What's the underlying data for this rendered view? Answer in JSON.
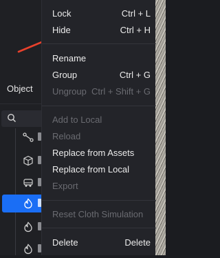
{
  "panel": {
    "tab_label": "Object"
  },
  "menu": {
    "items": [
      {
        "label": "Lock",
        "shortcut": "Ctrl + L",
        "enabled": true
      },
      {
        "label": "Hide",
        "shortcut": "Ctrl + H",
        "enabled": true
      },
      {
        "label": "Rename",
        "shortcut": "",
        "enabled": true
      },
      {
        "label": "Group",
        "shortcut": "Ctrl + G",
        "enabled": true
      },
      {
        "label": "Ungroup",
        "shortcut": "Ctrl + Shift + G",
        "enabled": false
      },
      {
        "label": "Add to Local",
        "shortcut": "",
        "enabled": false
      },
      {
        "label": "Reload",
        "shortcut": "",
        "enabled": false
      },
      {
        "label": "Replace from Assets",
        "shortcut": "",
        "enabled": true
      },
      {
        "label": "Replace from Local",
        "shortcut": "",
        "enabled": true
      },
      {
        "label": "Export",
        "shortcut": "",
        "enabled": false
      },
      {
        "label": "Reset Cloth Simulation",
        "shortcut": "",
        "enabled": false
      },
      {
        "label": "Delete",
        "shortcut": "Delete",
        "enabled": true
      }
    ]
  },
  "tree": {
    "icons": [
      "bone-icon",
      "cube-icon",
      "vehicle-icon",
      "cloth-icon",
      "cloth-icon",
      "cloth-icon"
    ],
    "selected_index": 3
  },
  "colors": {
    "accent": "#1a6ef5",
    "annotation_arrow": "#e8412c",
    "menu_bg": "#232429"
  }
}
